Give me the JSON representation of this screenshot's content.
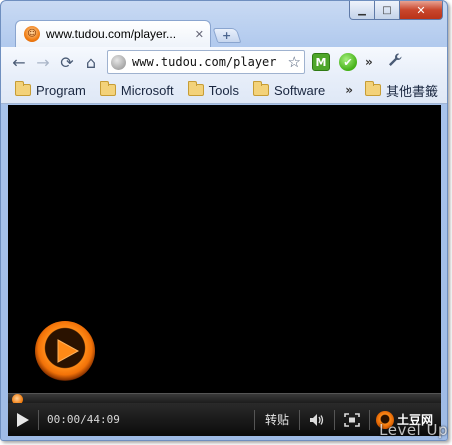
{
  "window": {
    "controls": {
      "minimize": "▁",
      "maximize": "□",
      "close": "✕"
    }
  },
  "tab": {
    "title": "www.tudou.com/player...",
    "favicon_glyph": "☺",
    "close": "✕",
    "new_tab": "+"
  },
  "toolbar": {
    "back": "←",
    "forward": "→",
    "reload": "⟳",
    "home": "⌂",
    "url": "www.tudou.com/player",
    "star": "☆",
    "ext_m": "M",
    "ext_check": "✔",
    "overflow": "»",
    "wrench": "🔧"
  },
  "bookmarks": {
    "items": [
      {
        "label": "Program"
      },
      {
        "label": "Microsoft"
      },
      {
        "label": "Tools"
      },
      {
        "label": "Software"
      }
    ],
    "overflow": "»",
    "other": "其他書籤"
  },
  "player": {
    "time": "00:00/44:09",
    "repost": "转贴",
    "logo_text": "土豆网",
    "progress": 0
  },
  "watermark": "Level Up",
  "colors": {
    "accent_orange": "#f27208",
    "player_bg": "#000000",
    "chrome_blue": "#a9c4ec"
  }
}
